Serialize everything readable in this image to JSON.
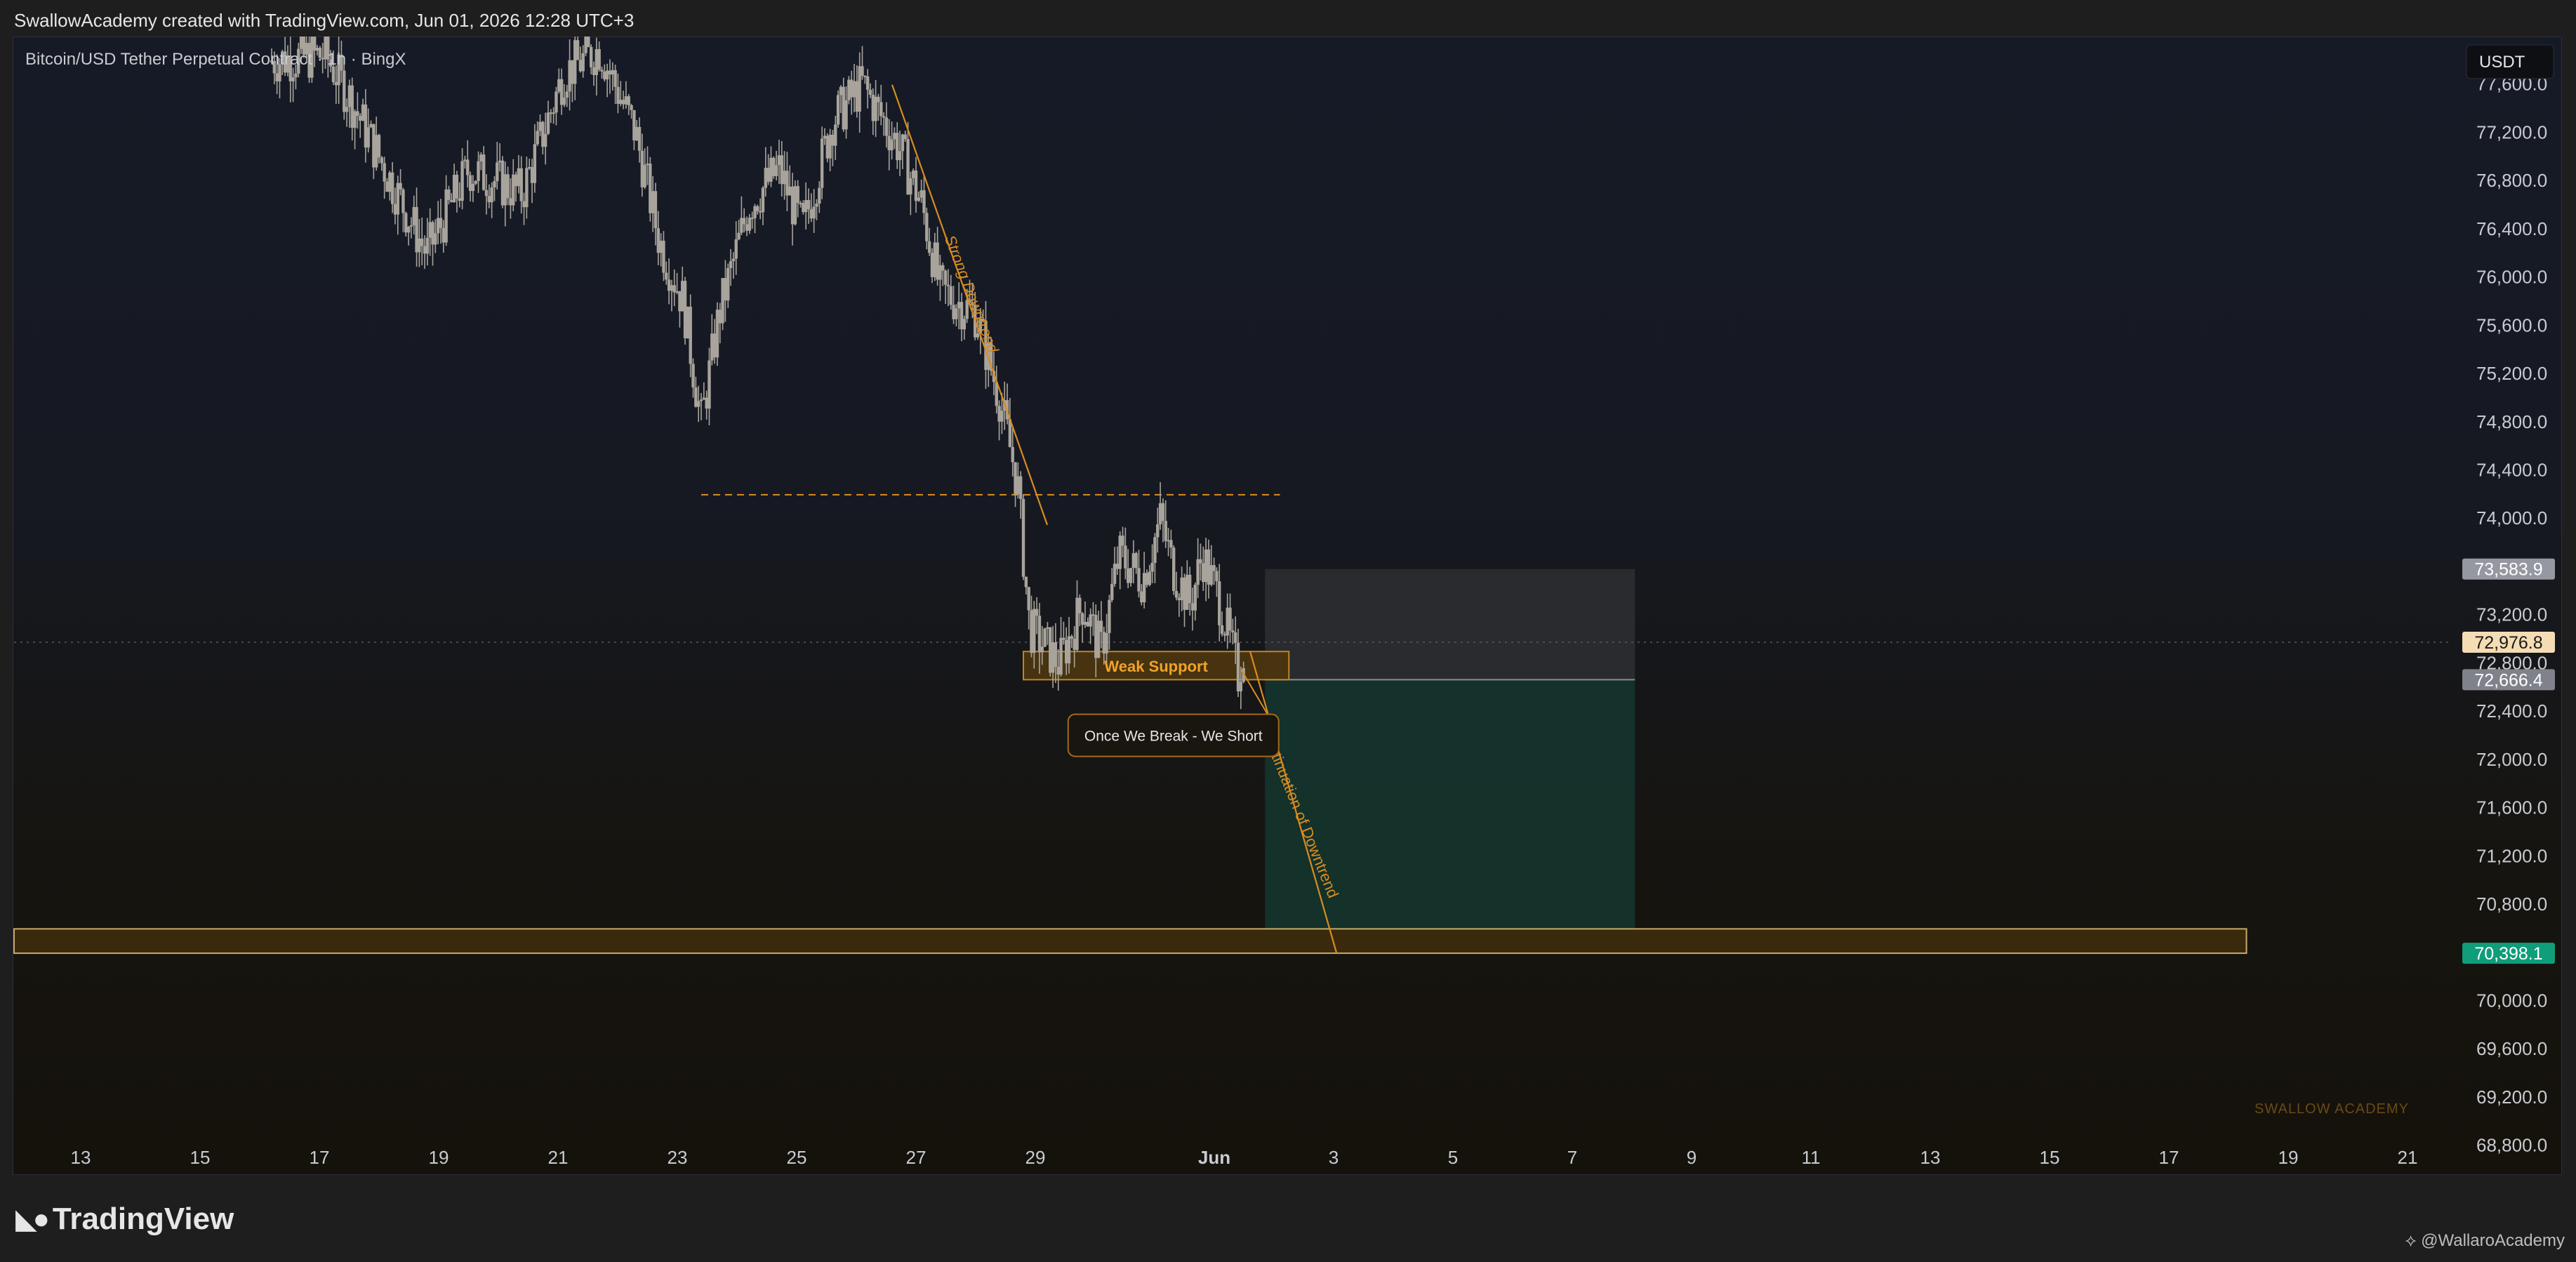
{
  "header": {
    "credit": "SwallowAcademy created with TradingView.com, Jun 01, 2026 12:28 UTC+3"
  },
  "chart_data": {
    "type": "candlestick",
    "title": "Bitcoin/USD Tether Perpetual Contract · 1h · BingX",
    "currency": "USDT",
    "ylim": [
      68600,
      78000
    ],
    "y_ticks": [
      68800,
      69200,
      69600,
      70000,
      70400,
      70800,
      71200,
      71600,
      72000,
      72400,
      72800,
      73200,
      73600,
      74000,
      74400,
      74800,
      75200,
      75600,
      76000,
      76400,
      76800,
      77200,
      77600
    ],
    "y_tick_labels": [
      "68,800.0",
      "69,200.0",
      "69,600.0",
      "70,000.0",
      "70,400.0",
      "70,800.0",
      "71,200.0",
      "71,600.0",
      "72,000.0",
      "72,400.0",
      "72,800.0",
      "73,200.0",
      "73,600.0",
      "74,000.0",
      "74,400.0",
      "74,800.0",
      "75,200.0",
      "75,600.0",
      "76,000.0",
      "76,400.0",
      "76,800.0",
      "77,200.0",
      "77,600.0"
    ],
    "x_tick_labels": [
      "13",
      "15",
      "17",
      "19",
      "21",
      "23",
      "25",
      "27",
      "29",
      "Jun",
      "3",
      "5",
      "7",
      "9",
      "11",
      "13",
      "15",
      "17",
      "19",
      "21"
    ],
    "x_tick_days": [
      -19,
      -17,
      -15,
      -13,
      -11,
      -9,
      -7,
      -5,
      -3,
      0,
      2,
      4,
      6,
      8,
      10,
      12,
      14,
      16,
      18,
      20
    ],
    "price_path": [
      {
        "day": -15.8,
        "price": 77800
      },
      {
        "day": -14.9,
        "price": 77850
      },
      {
        "day": -14.5,
        "price": 77500
      },
      {
        "day": -13.8,
        "price": 76800
      },
      {
        "day": -13.2,
        "price": 76200
      },
      {
        "day": -12.5,
        "price": 76900
      },
      {
        "day": -11.6,
        "price": 76700
      },
      {
        "day": -10.9,
        "price": 77700
      },
      {
        "day": -10.3,
        "price": 77900
      },
      {
        "day": -9.7,
        "price": 77200
      },
      {
        "day": -9.3,
        "price": 76300
      },
      {
        "day": -8.9,
        "price": 75800
      },
      {
        "day": -8.6,
        "price": 74800
      },
      {
        "day": -8.3,
        "price": 75700
      },
      {
        "day": -7.8,
        "price": 76600
      },
      {
        "day": -7.3,
        "price": 76900
      },
      {
        "day": -6.9,
        "price": 76400
      },
      {
        "day": -6.4,
        "price": 77300
      },
      {
        "day": -5.9,
        "price": 77600
      },
      {
        "day": -5.3,
        "price": 77100
      },
      {
        "day": -4.9,
        "price": 76600
      },
      {
        "day": -4.6,
        "price": 75900
      },
      {
        "day": -4.0,
        "price": 75700
      },
      {
        "day": -3.6,
        "price": 75000
      },
      {
        "day": -3.3,
        "price": 74300
      },
      {
        "day": -3.1,
        "price": 73100
      },
      {
        "day": -2.6,
        "price": 72800
      },
      {
        "day": -2.2,
        "price": 73300
      },
      {
        "day": -1.9,
        "price": 72900
      },
      {
        "day": -1.6,
        "price": 73700
      },
      {
        "day": -1.2,
        "price": 73500
      },
      {
        "day": -0.9,
        "price": 74000
      },
      {
        "day": -0.7,
        "price": 73600
      },
      {
        "day": -0.4,
        "price": 73300
      },
      {
        "day": -0.2,
        "price": 73700
      },
      {
        "day": 0.1,
        "price": 73300
      },
      {
        "day": 0.4,
        "price": 72700
      },
      {
        "day": 0.5,
        "price": 72950
      }
    ],
    "levels": {
      "resistance_dashed": 74200,
      "weak_support_low": 72666.4,
      "weak_support_high": 72900,
      "target_zone_low": 70398.1,
      "target_zone_high": 70600,
      "short_stop": 73583.9,
      "short_entry": 72666.4,
      "short_target": 70398.1
    },
    "annotations": {
      "weak_support": "Weak Support",
      "callout": "Once We Break - We Short",
      "strong_downtrend": "Strong Downtrend",
      "continuation": "Continuation of Downtrend",
      "watermark": "SWALLOW ACADEMY"
    },
    "price_badges": [
      {
        "value": 73583.9,
        "label": "73,583.9",
        "color": "#9598a1"
      },
      {
        "value": 72976.8,
        "label": "72,976.8",
        "color": "#f4dcb4"
      },
      {
        "value": 72666.4,
        "label": "72,666.4",
        "color": "#7f828b"
      },
      {
        "value": 70398.1,
        "label": "70,398.1",
        "color": "#0f9d7a"
      }
    ],
    "colors": {
      "candles": "#a8a49c",
      "orange": "#d98c1e",
      "zone_fill": "#3a2a0c",
      "profit_zone": "#14362f",
      "loss_zone": "#2e2f33"
    }
  },
  "footer": {
    "brand": "TradingView",
    "credit_right": "@WallaroAcademy"
  }
}
